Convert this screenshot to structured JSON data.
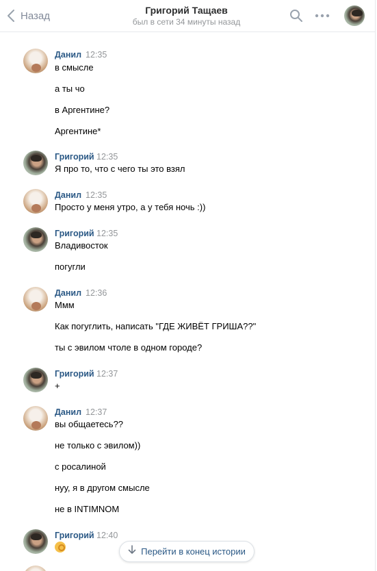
{
  "header": {
    "back_label": "Назад",
    "peer_name": "Григорий Тащаев",
    "peer_status": "был в сети 34 минуты назад"
  },
  "icons": {
    "back": "chevron-left-icon",
    "search": "search-icon",
    "more": "more-dots-icon",
    "jump": "arrow-down-icon",
    "emoji": "ok-hand-emoji"
  },
  "colors": {
    "author_link": "#2a5885",
    "muted": "#939699",
    "divider": "#e7e8ec"
  },
  "groups": [
    {
      "author": "Данил",
      "time": "12:35",
      "messages": [
        "в смысле",
        "а ты чо",
        "в Аргентине?",
        "Аргентине*"
      ]
    },
    {
      "author": "Григорий",
      "time": "12:35",
      "messages": [
        "Я про то, что с чего ты это взял"
      ]
    },
    {
      "author": "Данил",
      "time": "12:35",
      "messages": [
        "Просто у меня утро, а у тебя ночь :))"
      ]
    },
    {
      "author": "Григорий",
      "time": "12:35",
      "messages": [
        "Владивосток",
        "погугли"
      ]
    },
    {
      "author": "Данил",
      "time": "12:36",
      "messages": [
        "Ммм",
        "Как погуглить, написать \"ГДЕ ЖИВЁТ ГРИША??\"",
        "ты с эвилом чтоле в одном городе?"
      ]
    },
    {
      "author": "Григорий",
      "time": "12:37",
      "messages": [
        "+"
      ]
    },
    {
      "author": "Данил",
      "time": "12:37",
      "messages": [
        "вы общаетесь??",
        "не только с эвилом))",
        "с росалиной",
        "нуу, я в другом смысле",
        "не в INTIMNOM"
      ]
    },
    {
      "author": "Григорий",
      "time": "12:40",
      "messages": []
    }
  ],
  "jump_button": {
    "label": "Перейти в конец истории"
  }
}
